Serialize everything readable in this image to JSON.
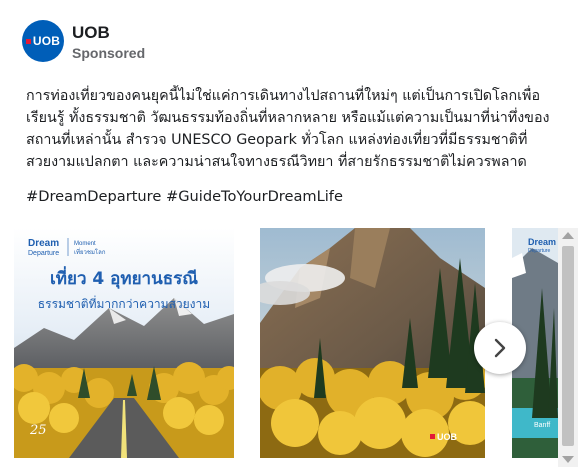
{
  "advertiser": {
    "name": "UOB",
    "avatar_text": "UOB",
    "sponsored_label": "Sponsored"
  },
  "post": {
    "lines": [
      "การท่องเที่ยวของคนยุคนี้ไม่ใช่แค่การเดินทางไปสถานที่ใหม่ๆ แต่เป็นการเปิดโลกเพื่อ",
      "เรียนรู้ ทั้งธรรมชาติ วัฒนธรรมท้องถิ่นที่หลากหลาย หรือแม้แต่ความเป็นมาที่น่าทึ่งของ",
      "สถานที่เหล่านั้น สำรวจ UNESCO Geopark ทั่วโลก แหล่งท่องเที่ยวที่มีธรรมชาติที่",
      "สวยงามแปลกตา และความน่าสนใจทางธรณีวิทยา ที่สายรักธรรมชาติไม่ควรพลาด"
    ],
    "hashtags": "#DreamDeparture #GuideToYourDreamLife"
  },
  "carousel": {
    "card1": {
      "logo_top": "Dream",
      "logo_bottom": "Departure",
      "tagline_1": "Moment",
      "tagline_2": "เที่ยวชมโลก",
      "headline": "เที่ยว 4 อุทยานธรณี",
      "subheadline": "ธรรมชาติที่มากกว่าความสวยงาม",
      "badge": "25"
    },
    "card2": {
      "brand_mark": "UOB"
    },
    "card3": {
      "logo_top": "Dream",
      "logo_bottom": "Departure",
      "caption": "Banff"
    },
    "next_icon": "chevron-right-icon"
  },
  "colors": {
    "brand_blue": "#005eb8",
    "brand_red": "#e31937",
    "headline_blue": "#1f5fb0"
  }
}
